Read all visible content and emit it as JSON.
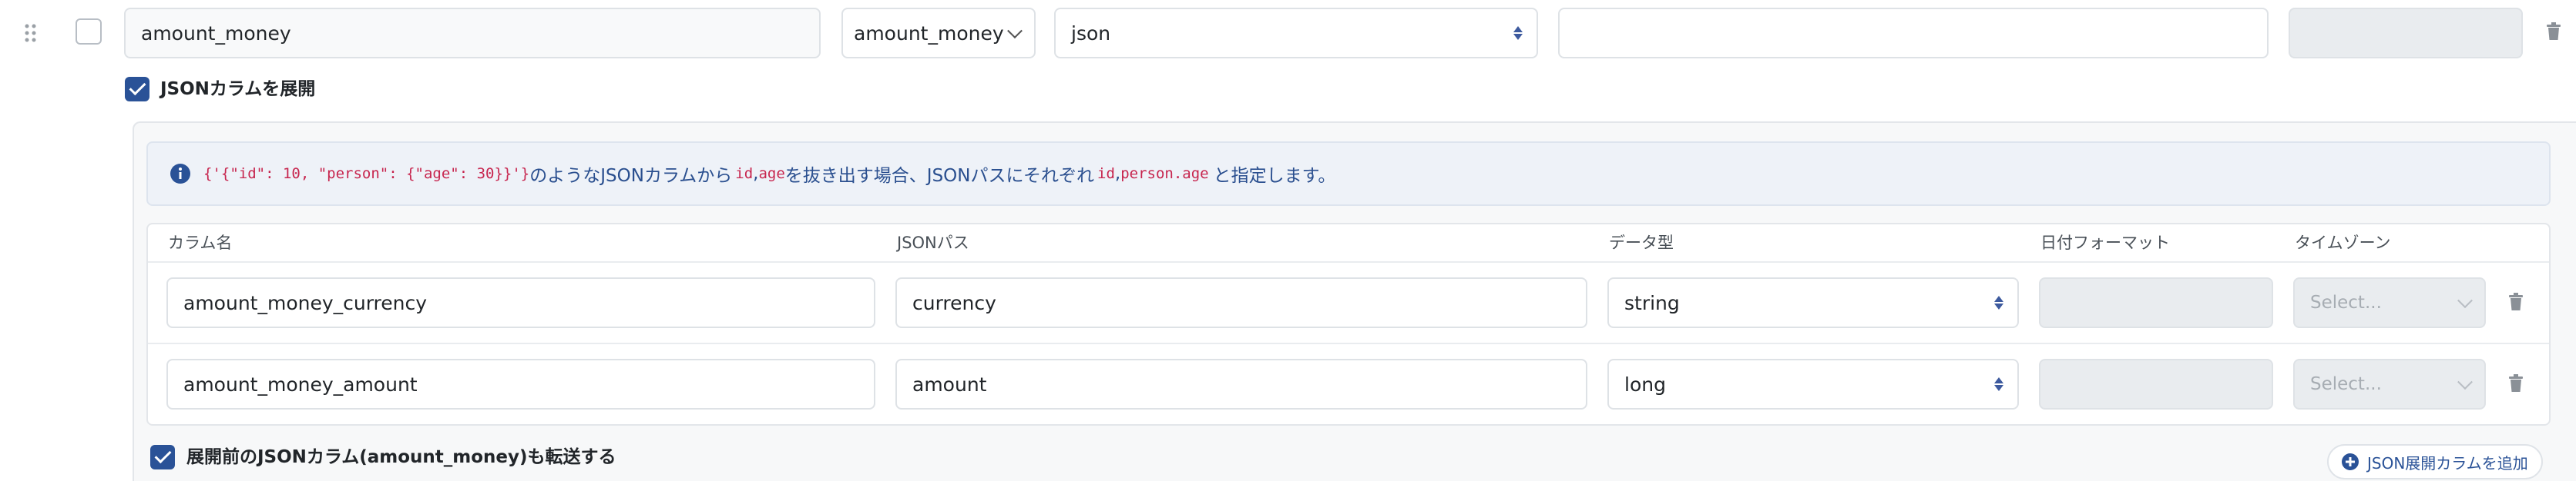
{
  "column": {
    "name_value": "amount_money",
    "source_select": "amount_money",
    "type_select": "json",
    "expand_label": "JSONカラムを展開"
  },
  "info": {
    "example_code": "{'{\"id\": 10, \"person\": {\"age\": 30}}'}",
    "text1": "のようなJSONカラムから",
    "code_id": "id",
    "comma1": ",",
    "code_age": "age",
    "text2": "を抜き出す場合、JSONパスにそれぞれ",
    "code_id2": "id",
    "comma2": ",",
    "code_person_age": "person.age",
    "text3": "と指定します。"
  },
  "table": {
    "headers": {
      "name": "カラム名",
      "path": "JSONパス",
      "type": "データ型",
      "date_format": "日付フォーマット",
      "timezone": "タイムゾーン"
    },
    "rows": [
      {
        "name": "amount_money_currency",
        "path": "currency",
        "type": "string",
        "timezone_placeholder": "Select..."
      },
      {
        "name": "amount_money_amount",
        "path": "amount",
        "type": "long",
        "timezone_placeholder": "Select..."
      }
    ]
  },
  "footer": {
    "transfer_label": "展開前のJSONカラム(amount_money)も転送する",
    "add_button": "JSON展開カラムを追加"
  },
  "colors": {
    "primary": "#2a5297",
    "info_bg": "#eef2f8",
    "code": "#c7254e"
  },
  "icons": [
    "drag-handle-icon",
    "info-icon",
    "trash-icon",
    "plus-circle-icon",
    "chevron-down-icon",
    "select-arrows-icon",
    "check-icon"
  ]
}
